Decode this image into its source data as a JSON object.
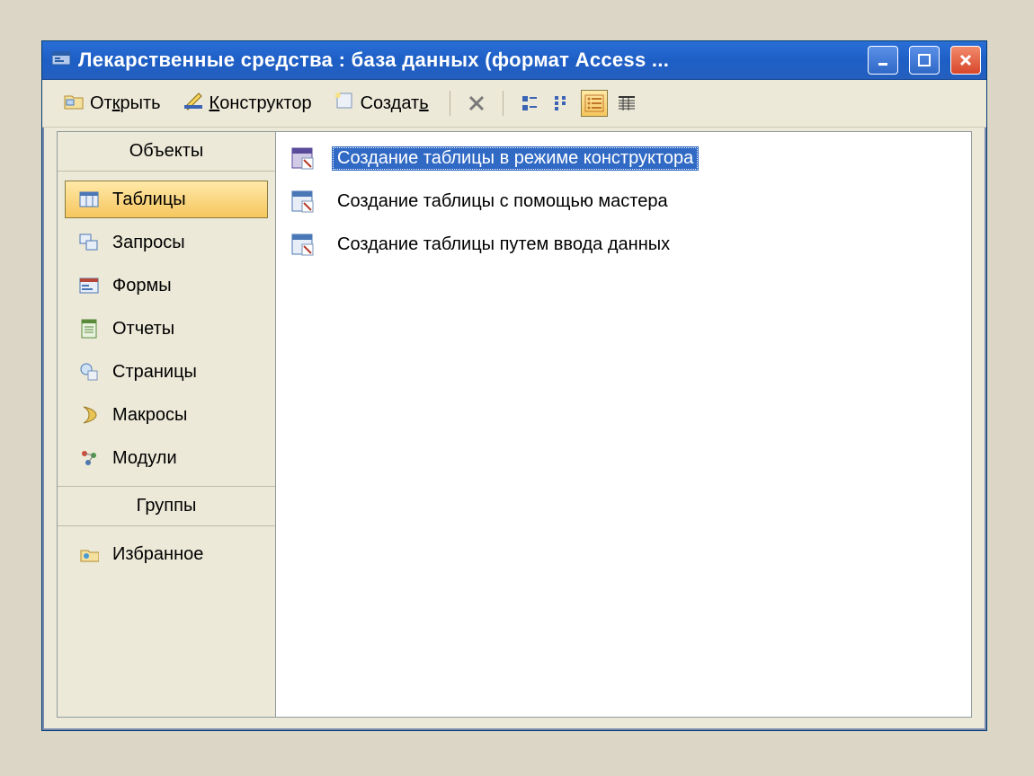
{
  "window": {
    "title": "Лекарственные средства : база данных (формат Access ..."
  },
  "toolbar": {
    "open": "Открыть",
    "design": "Конструктор",
    "new": "Создать"
  },
  "sidebar": {
    "objects_header": "Объекты",
    "groups_header": "Группы",
    "items": [
      {
        "label": "Таблицы"
      },
      {
        "label": "Запросы"
      },
      {
        "label": "Формы"
      },
      {
        "label": "Отчеты"
      },
      {
        "label": "Страницы"
      },
      {
        "label": "Макросы"
      },
      {
        "label": "Модули"
      }
    ],
    "favorites": "Избранное"
  },
  "content": {
    "items": [
      {
        "label": "Создание таблицы в режиме конструктора"
      },
      {
        "label": "Создание таблицы с помощью мастера"
      },
      {
        "label": "Создание таблицы путем ввода данных"
      }
    ]
  }
}
